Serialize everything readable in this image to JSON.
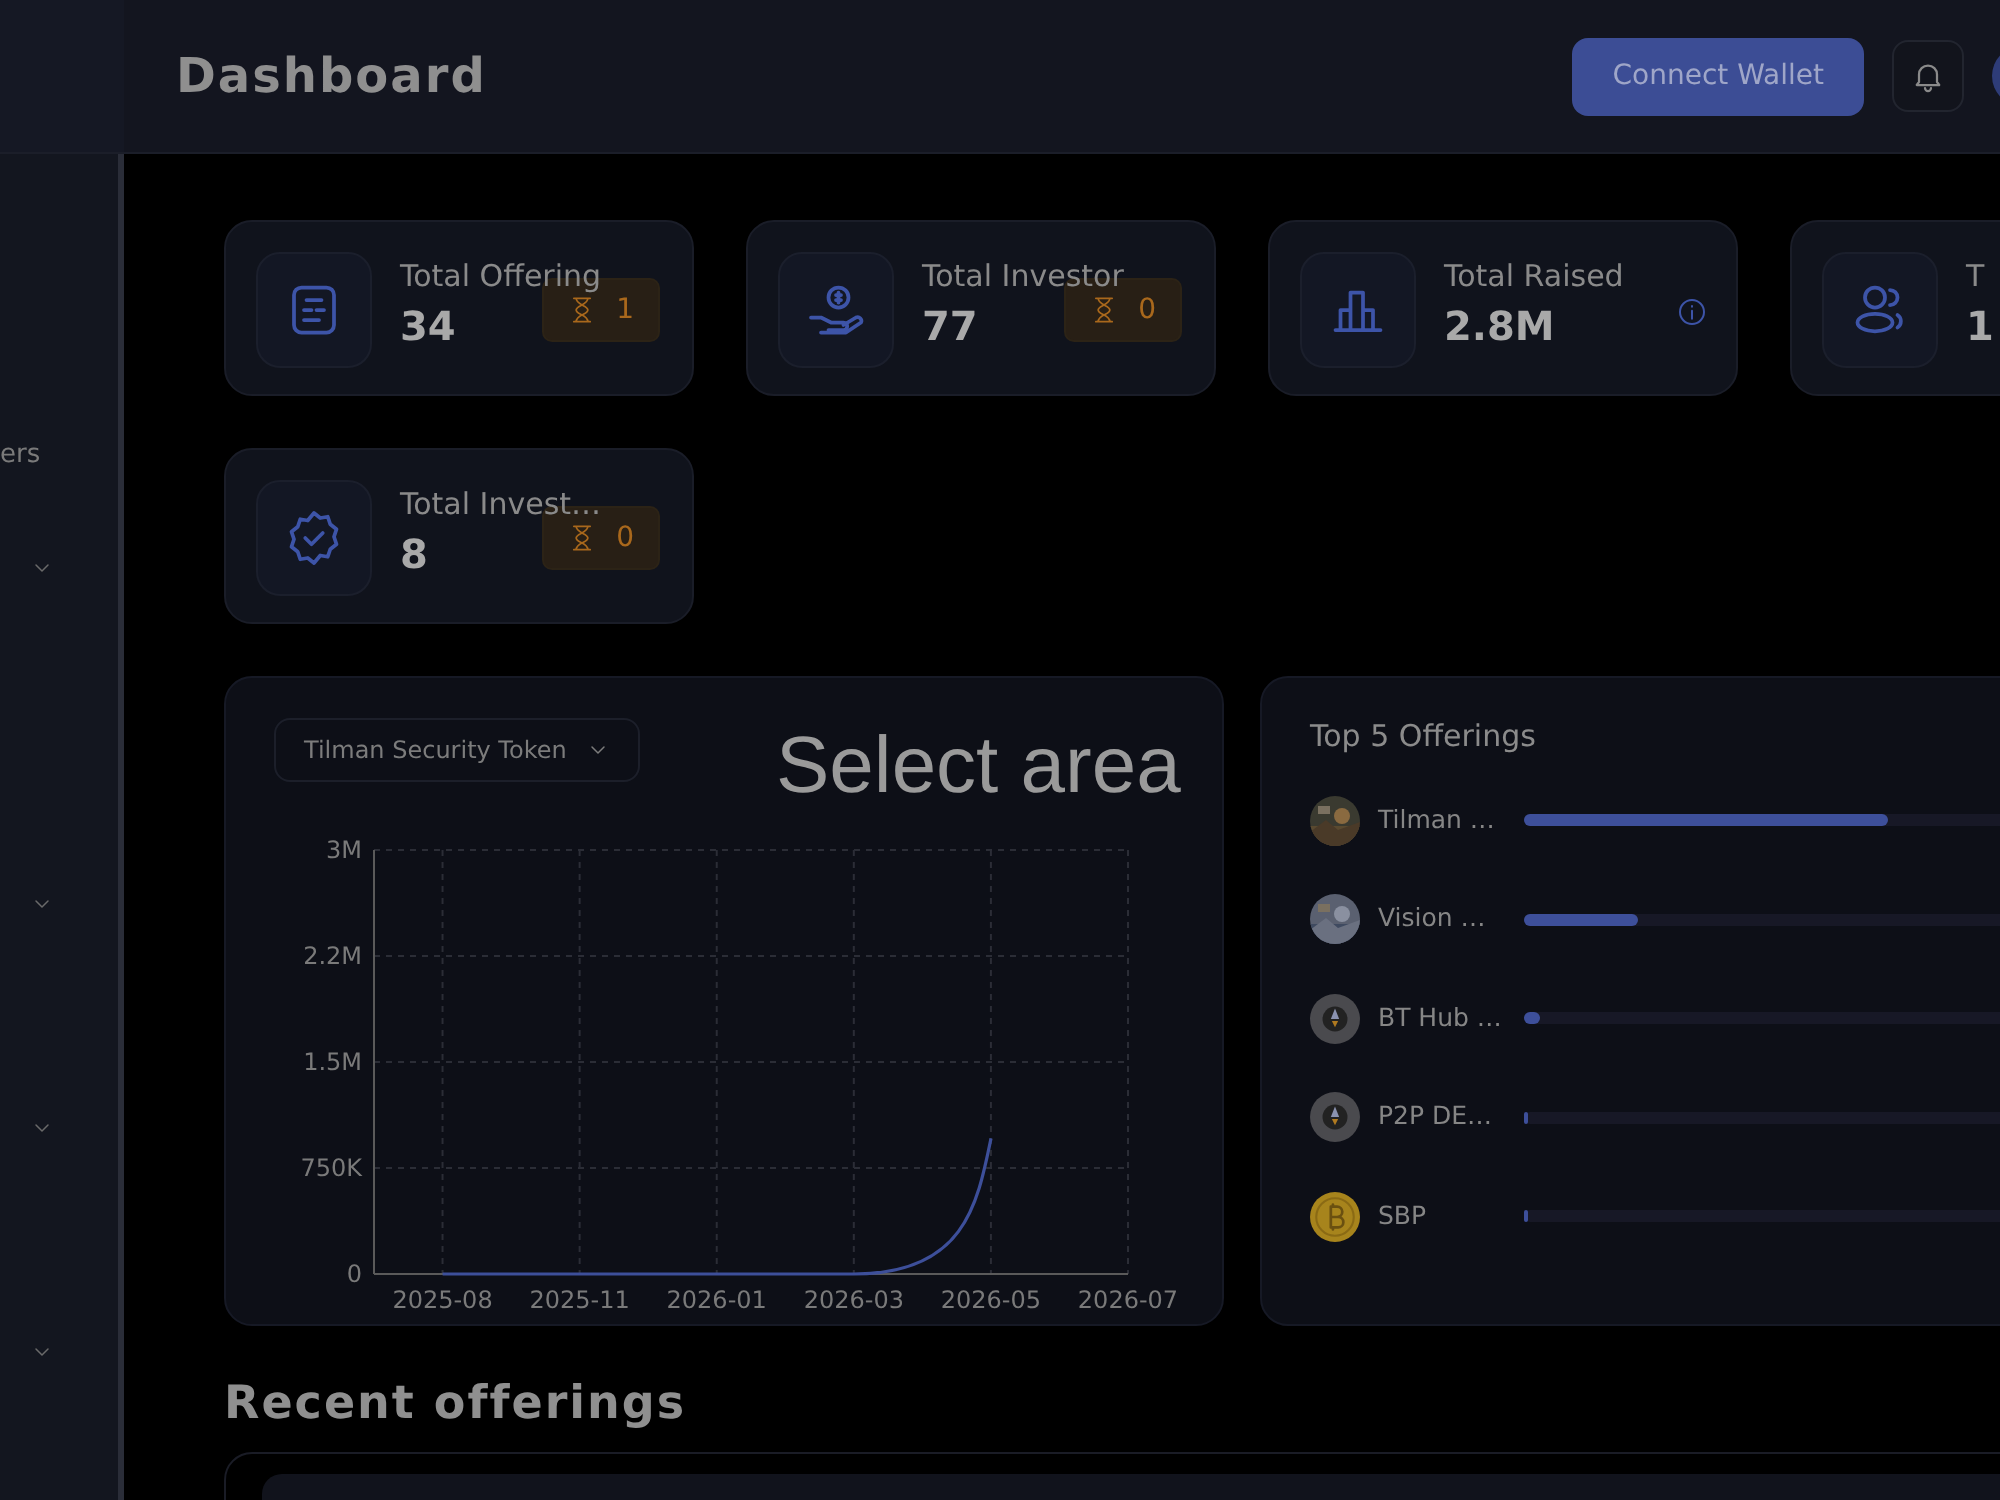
{
  "header": {
    "title": "Dashboard",
    "connect_button": "Connect Wallet"
  },
  "sidebar": {
    "items": [
      {
        "kind": "label",
        "label": "ers"
      },
      {
        "kind": "group",
        "expanded": false
      },
      {
        "kind": "group",
        "expanded": false
      },
      {
        "kind": "group",
        "expanded": false
      },
      {
        "kind": "group",
        "expanded": false
      }
    ]
  },
  "stats": [
    {
      "kind": "list",
      "label": "Total Offering",
      "value": "34",
      "pending": "1"
    },
    {
      "kind": "money",
      "label": "Total Investor",
      "value": "77",
      "pending": "0"
    },
    {
      "kind": "chart",
      "label": "Total Raised",
      "value": "2.8M",
      "info": true
    },
    {
      "kind": "users",
      "label": "T",
      "value": "1"
    },
    {
      "kind": "verified",
      "label": "Total Invest…",
      "value": "8",
      "pending": "0"
    }
  ],
  "chart_panel": {
    "token_select": "Tilman Security Token",
    "chart_data": {
      "type": "line",
      "categories": [
        "2025-08",
        "2025-11",
        "2026-01",
        "2026-03",
        "2026-05",
        "2026-07"
      ],
      "series": [
        {
          "color": "#3d4f9a",
          "values": [
            0,
            0,
            0,
            0,
            960000,
            null
          ]
        }
      ],
      "ylim": [
        0,
        3000000
      ],
      "grid": true,
      "yticks": [
        {
          "value": 0,
          "label": "0"
        },
        {
          "value": 750000,
          "label": "750K"
        },
        {
          "value": 1500000,
          "label": "1.5M"
        },
        {
          "value": 2250000,
          "label": "2.2M"
        },
        {
          "value": 3000000,
          "label": "3M"
        }
      ]
    }
  },
  "overlay": {
    "text": "Select area"
  },
  "top_offerings": {
    "title": "Top 5 Offerings",
    "items": [
      {
        "name": "Tilman …",
        "level": 0.48,
        "kind": "picture"
      },
      {
        "name": "Vision …",
        "level": 0.15,
        "kind": "picture"
      },
      {
        "name": "BT Hub …",
        "level": 0.02,
        "kind": "rocket"
      },
      {
        "name": "P2P DE…",
        "level": 0.005,
        "kind": "rocket"
      },
      {
        "name": "SBP",
        "level": 0.005,
        "kind": "bitcoin"
      }
    ]
  },
  "recent": {
    "title": "Recent offerings"
  }
}
